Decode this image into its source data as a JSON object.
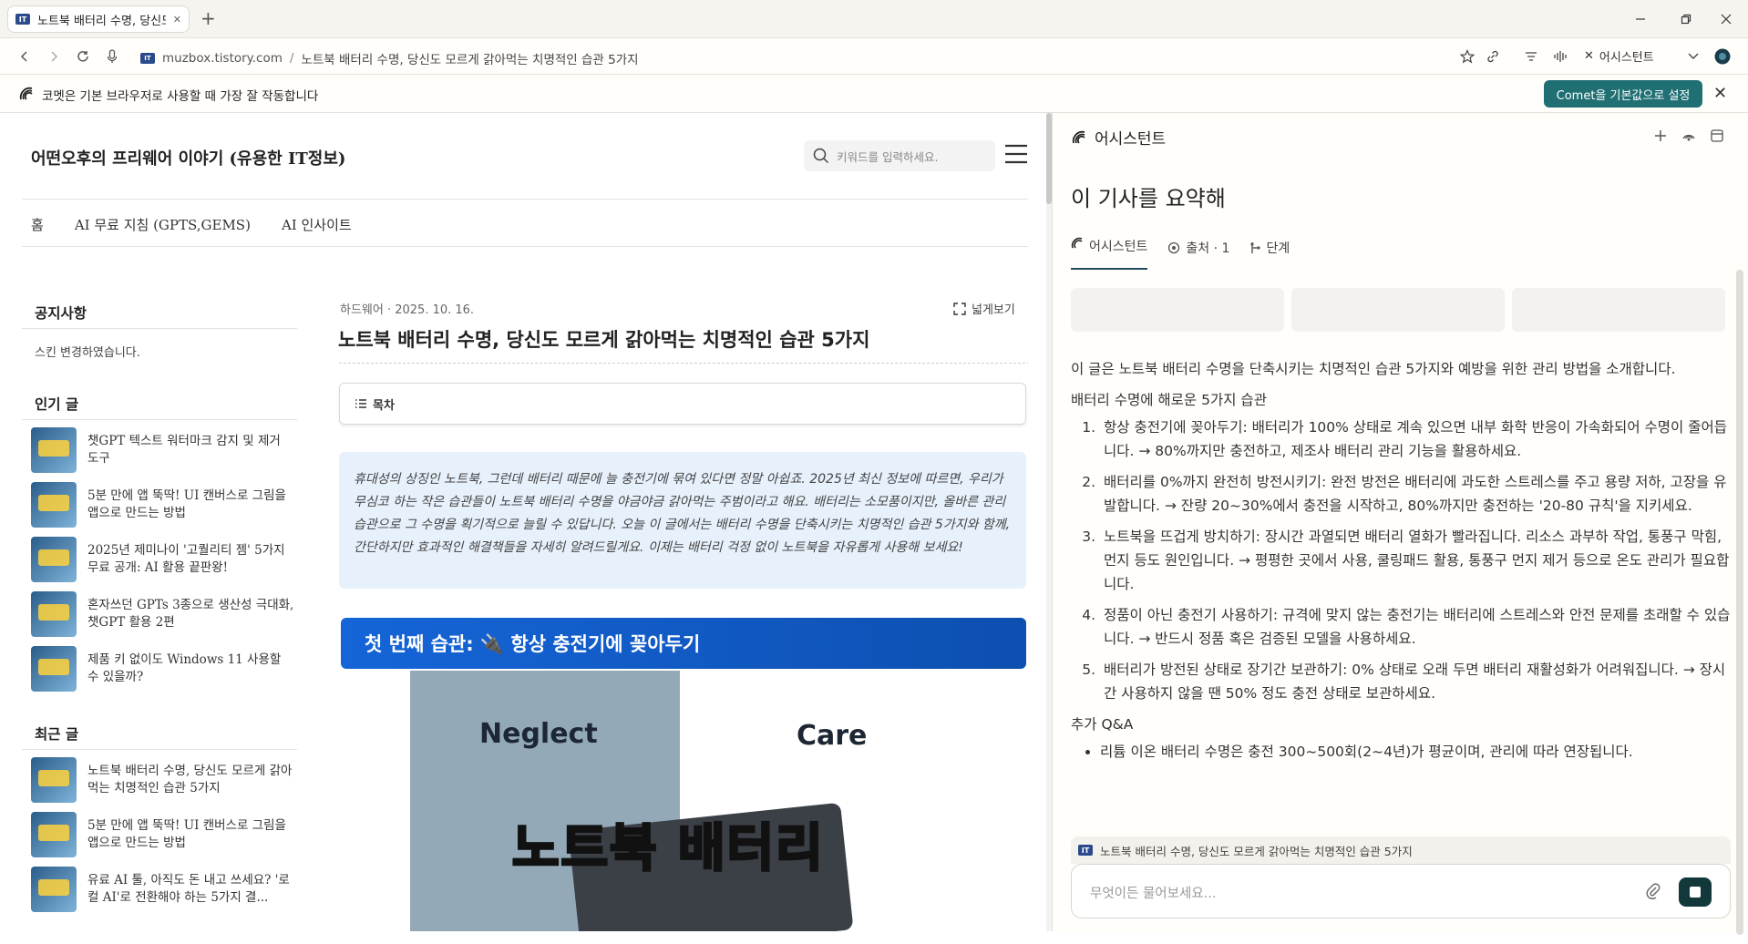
{
  "browser": {
    "tab_title": "노트북 배터리 수명, 당신도 모르게 갉아먹는 치명적인 습관 5가지",
    "favicon_text": "IT",
    "new_tab": "+",
    "url_domain": "muzbox.tistory.com",
    "url_sep": "/",
    "url_title": "노트북 배터리 수명, 당신도 모르게 갉아먹는 치명적인 습관 5가지",
    "assistant_button": "어시스턴트",
    "notice_text": "코멧은 기본 브라우저로 사용할 때 가장 잘 작동합니다",
    "set_default_button": "Comet을 기본값으로 설정"
  },
  "blog": {
    "title": "어떤오후의 프리웨어 이야기 (유용한 IT정보)",
    "search_placeholder": "키워드를 입력하세요.",
    "nav": [
      "홈",
      "AI 무료 지침 (GPTS,GEMS)",
      "AI 인사이트"
    ],
    "notice_head": "공지사항",
    "notice_item": "스킨 변경하였습니다.",
    "popular_head": "인기 글",
    "popular": [
      "챗GPT 텍스트 워터마크 감지 및 제거 도구",
      "5분 만에 앱 뚝딱! UI 캔버스로 그림을 앱으로 만드는 방법",
      "2025년 제미나이 '고퀄리티 젬' 5가지 무료 공개: AI 활용 끝판왕!",
      "혼자쓰던 GPTs 3종으로 생산성 극대화, 챗GPT 활용 2편",
      "제품 키 없이도 Windows 11 사용할 수 있을까?"
    ],
    "recent_head": "최근 글",
    "recent": [
      "노트북 배터리 수명, 당신도 모르게 갉아먹는 치명적인 습관 5가지",
      "5분 만에 앱 뚝딱! UI 캔버스로 그림을 앱으로 만드는 방법",
      "유료 AI 툴, 아직도 돈 내고 쓰세요? '로컬 AI'로 전환해야 하는 5가지 결..."
    ]
  },
  "post": {
    "meta": "하드웨어 · 2025. 10. 16.",
    "wide_view": "넓게보기",
    "title": "노트북 배터리 수명, 당신도 모르게 갉아먹는 치명적인 습관 5가지",
    "toc_label": "목차",
    "intro": "휴대성의 상징인 노트북, 그런데 배터리 때문에 늘 충전기에 묶여 있다면 정말 아쉽죠. 2025년 최신 정보에 따르면, 우리가 무심코 하는 작은 습관들이 노트북 배터리 수명을 야금야금 갉아먹는 주범이라고 해요. 배터리는 소모품이지만, 올바른 관리 습관으로 그 수명을 획기적으로 늘릴 수 있답니다. 오늘 이 글에서는 배터리 수명을 단축시키는 치명적인 습관 5가지와 함께, 간단하지만 효과적인 해결책들을 자세히 알려드릴게요. 이제는 배터리 걱정 없이 노트북을 자유롭게 사용해 보세요!",
    "section1": "첫 번째 습관: 🔌 항상 충전기에 꽂아두기",
    "hero_left": "Neglect",
    "hero_right": "Care",
    "hero_overlay": "노트북 배터리"
  },
  "assistant": {
    "header": "어시스턴트",
    "query": "이 기사를 요약해",
    "tabs": {
      "assistant": "어시스턴트",
      "sources": "출처 · 1",
      "steps": "단계"
    },
    "summary": "이 글은 노트북 배터리 수명을 단축시키는 치명적인 습관 5가지와 예방을 위한 관리 방법을 소개합니다.",
    "list_head": "배터리 수명에 해로운 5가지 습관",
    "items": [
      "항상 충전기에 꽂아두기: 배터리가 100% 상태로 계속 있으면 내부 화학 반응이 가속화되어 수명이 줄어듭니다. → 80%까지만 충전하고, 제조사 배터리 관리 기능을 활용하세요.",
      "배터리를 0%까지 완전히 방전시키기: 완전 방전은 배터리에 과도한 스트레스를 주고 용량 저하, 고장을 유발합니다. → 잔량 20~30%에서 충전을 시작하고, 80%까지만 충전하는 '20-80 규칙'을 지키세요.",
      "노트북을 뜨겁게 방치하기: 장시간 과열되면 배터리 열화가 빨라집니다. 리소스 과부하 작업, 통풍구 막힘, 먼지 등도 원인입니다. → 평평한 곳에서 사용, 쿨링패드 활용, 통풍구 먼지 제거 등으로 온도 관리가 필요합니다.",
      "정품이 아닌 충전기 사용하기: 규격에 맞지 않는 충전기는 배터리에 스트레스와 안전 문제를 초래할 수 있습니다. → 반드시 정품 혹은 검증된 모델을 사용하세요.",
      "배터리가 방전된 상태로 장기간 보관하기: 0% 상태로 오래 두면 배터리 재활성화가 어려워집니다. → 장시간 사용하지 않을 땐 50% 정도 충전 상태로 보관하세요."
    ],
    "qa_head": "추가 Q&A",
    "qa": [
      "리튬 이온 배터리 수명은 충전 300~500회(2~4년)가 평균이며, 관리에 따라 연장됩니다."
    ],
    "source_chip": "노트북 배터리 수명, 당신도 모르게 갉아먹는 치명적인 습관 5가지",
    "composer_placeholder": "무엇이든 물어보세요..."
  },
  "colors": {
    "accent": "#1f6f73",
    "section": "#1565d8",
    "intro_bg": "#e7f1fb",
    "send": "#12383c"
  }
}
